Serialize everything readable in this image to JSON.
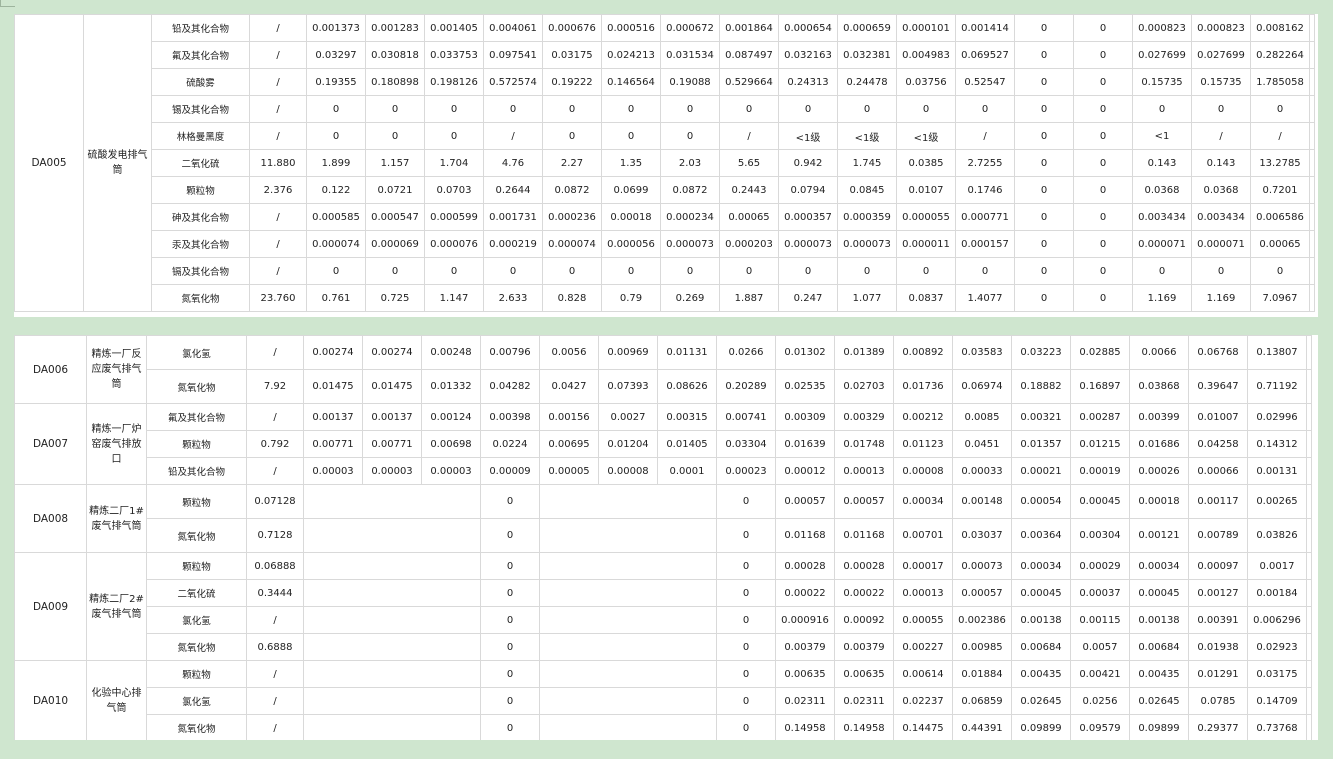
{
  "table1": {
    "group": {
      "code": "DA005",
      "name": "硫酸发电排气筒"
    },
    "rows": [
      [
        "铅及其化合物",
        "/",
        "0.001373",
        "0.001283",
        "0.001405",
        "0.004061",
        "0.000676",
        "0.000516",
        "0.000672",
        "0.001864",
        "0.000654",
        "0.000659",
        "0.000101",
        "0.001414",
        "0",
        "0",
        "0.000823",
        "0.000823",
        "0.008162"
      ],
      [
        "氟及其化合物",
        "/",
        "0.03297",
        "0.030818",
        "0.033753",
        "0.097541",
        "0.03175",
        "0.024213",
        "0.031534",
        "0.087497",
        "0.032163",
        "0.032381",
        "0.004983",
        "0.069527",
        "0",
        "0",
        "0.027699",
        "0.027699",
        "0.282264"
      ],
      [
        "硫酸雾",
        "/",
        "0.19355",
        "0.180898",
        "0.198126",
        "0.572574",
        "0.19222",
        "0.146564",
        "0.19088",
        "0.529664",
        "0.24313",
        "0.24478",
        "0.03756",
        "0.52547",
        "0",
        "0",
        "0.15735",
        "0.15735",
        "1.785058"
      ],
      [
        "锡及其化合物",
        "/",
        "0",
        "0",
        "0",
        "0",
        "0",
        "0",
        "0",
        "0",
        "0",
        "0",
        "0",
        "0",
        "0",
        "0",
        "0",
        "0",
        "0"
      ],
      [
        "林格曼黑度",
        "/",
        "0",
        "0",
        "0",
        "/",
        "0",
        "0",
        "0",
        "/",
        "<1级",
        "<1级",
        "<1级",
        "/",
        "0",
        "0",
        "<1",
        "/",
        "/"
      ],
      [
        "二氧化硫",
        "11.880",
        "1.899",
        "1.157",
        "1.704",
        "4.76",
        "2.27",
        "1.35",
        "2.03",
        "5.65",
        "0.942",
        "1.745",
        "0.0385",
        "2.7255",
        "0",
        "0",
        "0.143",
        "0.143",
        "13.2785"
      ],
      [
        "颗粒物",
        "2.376",
        "0.122",
        "0.0721",
        "0.0703",
        "0.2644",
        "0.0872",
        "0.0699",
        "0.0872",
        "0.2443",
        "0.0794",
        "0.0845",
        "0.0107",
        "0.1746",
        "0",
        "0",
        "0.0368",
        "0.0368",
        "0.7201"
      ],
      [
        "砷及其化合物",
        "/",
        "0.000585",
        "0.000547",
        "0.000599",
        "0.001731",
        "0.000236",
        "0.00018",
        "0.000234",
        "0.00065",
        "0.000357",
        "0.000359",
        "0.000055",
        "0.000771",
        "0",
        "0",
        "0.003434",
        "0.003434",
        "0.006586"
      ],
      [
        "汞及其化合物",
        "/",
        "0.000074",
        "0.000069",
        "0.000076",
        "0.000219",
        "0.000074",
        "0.000056",
        "0.000073",
        "0.000203",
        "0.000073",
        "0.000073",
        "0.000011",
        "0.000157",
        "0",
        "0",
        "0.000071",
        "0.000071",
        "0.00065"
      ],
      [
        "镉及其化合物",
        "/",
        "0",
        "0",
        "0",
        "0",
        "0",
        "0",
        "0",
        "0",
        "0",
        "0",
        "0",
        "0",
        "0",
        "0",
        "0",
        "0",
        "0"
      ],
      [
        "氮氧化物",
        "23.760",
        "0.761",
        "0.725",
        "1.147",
        "2.633",
        "0.828",
        "0.79",
        "0.269",
        "1.887",
        "0.247",
        "1.077",
        "0.0837",
        "1.4077",
        "0",
        "0",
        "1.169",
        "1.169",
        "7.0967"
      ]
    ]
  },
  "table2": {
    "groups": [
      {
        "code": "DA006",
        "name": "精炼一厂反应废气排气筒",
        "rows": [
          [
            "氯化氢",
            "/",
            "0.00274",
            "0.00274",
            "0.00248",
            "0.00796",
            "0.0056",
            "0.00969",
            "0.01131",
            "0.0266",
            "0.01302",
            "0.01389",
            "0.00892",
            "0.03583",
            "0.03223",
            "0.02885",
            "0.0066",
            "0.06768",
            "0.13807"
          ],
          [
            "氮氧化物",
            "7.92",
            "0.01475",
            "0.01475",
            "0.01332",
            "0.04282",
            "0.0427",
            "0.07393",
            "0.08626",
            "0.20289",
            "0.02535",
            "0.02703",
            "0.01736",
            "0.06974",
            "0.18882",
            "0.16897",
            "0.03868",
            "0.39647",
            "0.71192"
          ]
        ]
      },
      {
        "code": "DA007",
        "name": "精炼一厂炉窑废气排放口",
        "rows": [
          [
            "氟及其化合物",
            "/",
            "0.00137",
            "0.00137",
            "0.00124",
            "0.00398",
            "0.00156",
            "0.0027",
            "0.00315",
            "0.00741",
            "0.00309",
            "0.00329",
            "0.00212",
            "0.0085",
            "0.00321",
            "0.00287",
            "0.00399",
            "0.01007",
            "0.02996"
          ],
          [
            "颗粒物",
            "0.792",
            "0.00771",
            "0.00771",
            "0.00698",
            "0.0224",
            "0.00695",
            "0.01204",
            "0.01405",
            "0.03304",
            "0.01639",
            "0.01748",
            "0.01123",
            "0.0451",
            "0.01357",
            "0.01215",
            "0.01686",
            "0.04258",
            "0.14312"
          ],
          [
            "铅及其化合物",
            "/",
            "0.00003",
            "0.00003",
            "0.00003",
            "0.00009",
            "0.00005",
            "0.00008",
            "0.0001",
            "0.00023",
            "0.00012",
            "0.00013",
            "0.00008",
            "0.00033",
            "0.00021",
            "0.00019",
            "0.00026",
            "0.00066",
            "0.00131"
          ]
        ]
      },
      {
        "code": "DA008",
        "name": "精炼二厂1#废气排气筒",
        "rows": [
          [
            "颗粒物",
            "0.07128",
            "",
            "",
            "",
            "0",
            "",
            "",
            "",
            "0",
            "0.00057",
            "0.00057",
            "0.00034",
            "0.00148",
            "0.00054",
            "0.00045",
            "0.00018",
            "0.00117",
            "0.00265"
          ],
          [
            "氮氧化物",
            "0.7128",
            "",
            "",
            "",
            "0",
            "",
            "",
            "",
            "0",
            "0.01168",
            "0.01168",
            "0.00701",
            "0.03037",
            "0.00364",
            "0.00304",
            "0.00121",
            "0.00789",
            "0.03826"
          ]
        ]
      },
      {
        "code": "DA009",
        "name": "精炼二厂2#废气排气筒",
        "rows": [
          [
            "颗粒物",
            "0.06888",
            "",
            "",
            "",
            "0",
            "",
            "",
            "",
            "0",
            "0.00028",
            "0.00028",
            "0.00017",
            "0.00073",
            "0.00034",
            "0.00029",
            "0.00034",
            "0.00097",
            "0.0017"
          ],
          [
            "二氧化硫",
            "0.3444",
            "",
            "",
            "",
            "0",
            "",
            "",
            "",
            "0",
            "0.00022",
            "0.00022",
            "0.00013",
            "0.00057",
            "0.00045",
            "0.00037",
            "0.00045",
            "0.00127",
            "0.00184"
          ],
          [
            "氯化氢",
            "/",
            "",
            "",
            "",
            "0",
            "",
            "",
            "",
            "0",
            "0.000916",
            "0.00092",
            "0.00055",
            "0.002386",
            "0.00138",
            "0.00115",
            "0.00138",
            "0.00391",
            "0.006296"
          ],
          [
            "氮氧化物",
            "0.6888",
            "",
            "",
            "",
            "0",
            "",
            "",
            "",
            "0",
            "0.00379",
            "0.00379",
            "0.00227",
            "0.00985",
            "0.00684",
            "0.0057",
            "0.00684",
            "0.01938",
            "0.02923"
          ]
        ]
      },
      {
        "code": "DA010",
        "name": "化验中心排气筒",
        "rows": [
          [
            "颗粒物",
            "/",
            "",
            "",
            "",
            "0",
            "",
            "",
            "",
            "0",
            "0.00635",
            "0.00635",
            "0.00614",
            "0.01884",
            "0.00435",
            "0.00421",
            "0.00435",
            "0.01291",
            "0.03175"
          ],
          [
            "氯化氢",
            "/",
            "",
            "",
            "",
            "0",
            "",
            "",
            "",
            "0",
            "0.02311",
            "0.02311",
            "0.02237",
            "0.06859",
            "0.02645",
            "0.0256",
            "0.02645",
            "0.0785",
            "0.14709"
          ],
          [
            "氮氧化物",
            "/",
            "",
            "",
            "",
            "0",
            "",
            "",
            "",
            "0",
            "0.14958",
            "0.14958",
            "0.14475",
            "0.44391",
            "0.09899",
            "0.09579",
            "0.09899",
            "0.29377",
            "0.73768"
          ]
        ]
      }
    ]
  }
}
